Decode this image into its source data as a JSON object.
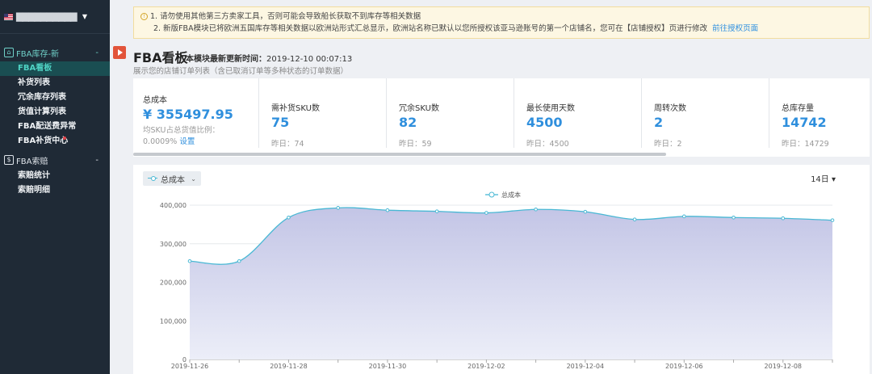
{
  "sidebar": {
    "account": {
      "name": "▇▇▇▇▇▇▇▇▇▇"
    },
    "groups": [
      {
        "label": "FBA库存-新",
        "toggle": "-"
      },
      {
        "label": "FBA索赔",
        "toggle": "-"
      }
    ],
    "inventory_items": [
      {
        "label": "FBA看板"
      },
      {
        "label": "补货列表"
      },
      {
        "label": "冗余库存列表"
      },
      {
        "label": "货值计算列表"
      },
      {
        "label": "FBA配送费异常"
      },
      {
        "label": "FBA补货中心"
      }
    ],
    "claim_items": [
      {
        "label": "索赔统计"
      },
      {
        "label": "索赔明细"
      }
    ]
  },
  "notice": {
    "line1": "1. 请勿使用其他第三方卖家工具，否则可能会导致船长获取不到库存等相关数据",
    "line2": "2. 新版FBA模块已将欧洲五国库存等相关数据以欧洲站形式汇总显示，欧洲站名称已默认以您所授权该亚马逊账号的第一个店铺名，您可在【店铺授权】页进行修改",
    "link": "前往授权页面"
  },
  "page": {
    "title": "FBA看板",
    "updated_label": "本模块最新更新时间：",
    "updated_value": "2019-12-10 00:07:13",
    "subtitle": "展示您的店铺订单列表（含已取消订单等多种状态的订单数据）"
  },
  "stats": {
    "total_cost": {
      "label": "总成本",
      "value": "¥ 355497.95",
      "note": "均SKU占总货值比例：",
      "note_value": "0.0009%",
      "link": "设置"
    },
    "cards": [
      {
        "label": "需补货SKU数",
        "value": "75",
        "yesterday": "昨日：74"
      },
      {
        "label": "冗余SKU数",
        "value": "82",
        "yesterday": "昨日：59"
      },
      {
        "label": "最长使用天数",
        "value": "4500",
        "yesterday": "昨日：4500"
      },
      {
        "label": "周转次数",
        "value": "2",
        "yesterday": "昨日：2"
      },
      {
        "label": "总库存量",
        "value": "14742",
        "yesterday": "昨日：14729"
      }
    ]
  },
  "chart": {
    "metric_select": "总成本",
    "range_select": "14日 ▾"
  },
  "colors": {
    "accent": "#2f8fdd",
    "line": "#49b8d4",
    "area": "#c3c5e6",
    "sidebar": "#1f2a36"
  },
  "chart_data": {
    "type": "area",
    "x": [
      "2019-11-26",
      "2019-11-27",
      "2019-11-28",
      "2019-11-29",
      "2019-11-30",
      "2019-12-01",
      "2019-12-02",
      "2019-12-03",
      "2019-12-04",
      "2019-12-05",
      "2019-12-06",
      "2019-12-07",
      "2019-12-08",
      "2019-12-09"
    ],
    "series": [
      {
        "name": "总成本",
        "values": [
          255000,
          255000,
          368000,
          393000,
          387000,
          384000,
          380000,
          389000,
          383000,
          363000,
          371000,
          368000,
          366000,
          361000
        ]
      }
    ],
    "ylim": [
      0,
      400000
    ],
    "yticks": [
      "0",
      "100,000",
      "200,000",
      "300,000",
      "400,000"
    ],
    "xticks": [
      "2019-11-26",
      "2019-11-28",
      "2019-11-30",
      "2019-12-02",
      "2019-12-04",
      "2019-12-06",
      "2019-12-08"
    ],
    "legend": "top-center",
    "grid": true
  }
}
